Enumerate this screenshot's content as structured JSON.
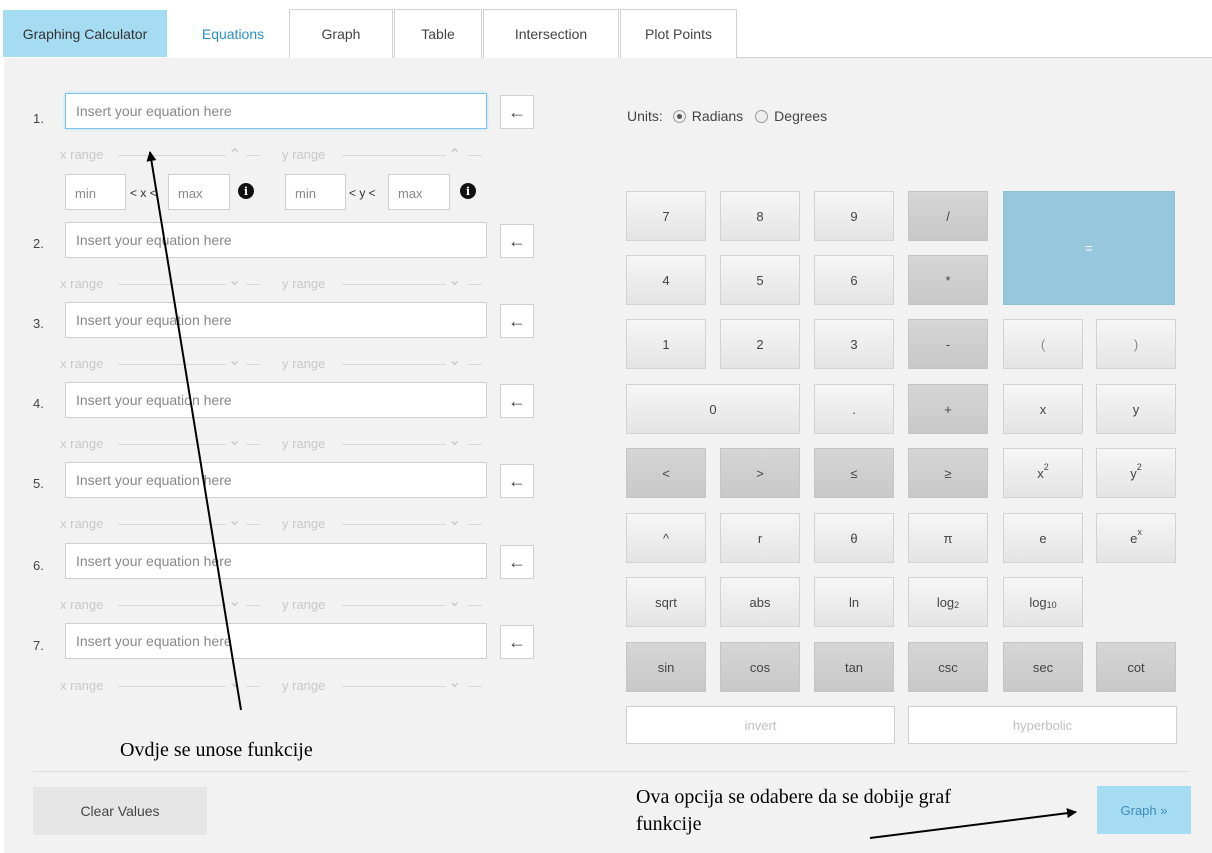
{
  "tabs": {
    "brand": "Graphing Calculator",
    "items": [
      "Equations",
      "Graph",
      "Table",
      "Intersection",
      "Plot Points"
    ]
  },
  "equations": {
    "placeholder": "Insert your equation here",
    "numbers": [
      "1.",
      "2.",
      "3.",
      "4.",
      "5.",
      "6.",
      "7."
    ],
    "back_symbol": "←",
    "x_range_label": "x range",
    "y_range_label": "y range",
    "collapse_symbol": "⌃",
    "expand_symbol": "⌄",
    "min_placeholder": "min",
    "max_placeholder": "max",
    "x_between": "< x <",
    "y_between": "< y <",
    "info_symbol": "i"
  },
  "units": {
    "label": "Units:",
    "options": [
      "Radians",
      "Degrees"
    ],
    "selected": "Radians"
  },
  "keypad": {
    "row1": [
      "7",
      "8",
      "9",
      "/"
    ],
    "row2": [
      "4",
      "5",
      "6",
      "*"
    ],
    "equals": "=",
    "row3": [
      "1",
      "2",
      "3",
      "-",
      "(",
      ")"
    ],
    "row4": [
      "0",
      ".",
      "+",
      "x",
      "y"
    ],
    "row5": [
      "<",
      ">",
      "≤",
      "≥"
    ],
    "x_squared": {
      "base": "x",
      "exp": "2"
    },
    "y_squared": {
      "base": "y",
      "exp": "2"
    },
    "row6": [
      "^",
      "r",
      "θ",
      "π",
      "e"
    ],
    "e_x": {
      "base": "e",
      "exp": "x"
    },
    "row7": [
      "sqrt",
      "abs",
      "ln"
    ],
    "log2": {
      "base": "log",
      "sub": "2"
    },
    "log10": {
      "base": "log",
      "sub": "10"
    },
    "row8": [
      "sin",
      "cos",
      "tan",
      "csc",
      "sec",
      "cot"
    ],
    "invert": "invert",
    "hyperbolic": "hyperbolic"
  },
  "bottom": {
    "clear": "Clear Values",
    "graph": "Graph »"
  },
  "annotations": {
    "functions_note": "Ovdje se unose funkcije",
    "graph_note_line1": "Ova opcija se odabere da se dobije graf",
    "graph_note_line2": "funkcije"
  }
}
